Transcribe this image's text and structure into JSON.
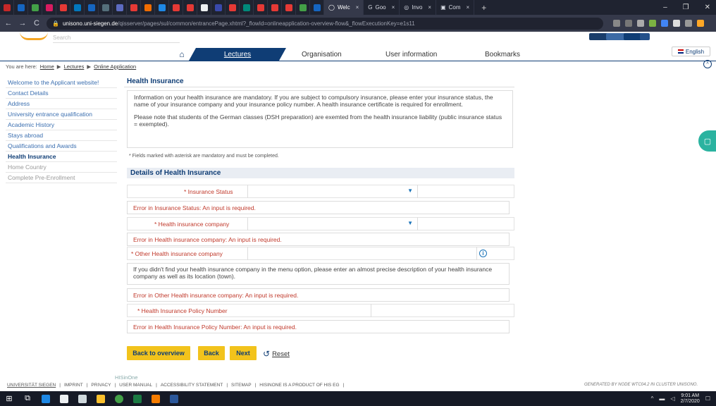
{
  "browser": {
    "tabs": [
      {
        "label": "Welc",
        "active": true
      },
      {
        "label": "Goo",
        "active": false
      },
      {
        "label": "Invo",
        "active": false
      },
      {
        "label": "Com",
        "active": false
      }
    ],
    "url_host": "unisono.uni-siegen.de",
    "url_path": "/qisserver/pages/sul/common/entrancePage.xhtml?_flowId=onlineapplication-overview-flow&_flowExecutionKey=e1s11"
  },
  "site": {
    "search_placeholder": "Search",
    "nav": {
      "home_icon": "home-icon",
      "active": "Lectures",
      "items": [
        "Organisation",
        "User information",
        "Bookmarks"
      ]
    },
    "language": "English"
  },
  "breadcrumb": {
    "prefix": "You are here:",
    "items": [
      "Home",
      "Lectures",
      "Online Application"
    ]
  },
  "sidebar": {
    "items": [
      {
        "label": "Welcome to the Applicant website!",
        "state": "link"
      },
      {
        "label": "Contact Details",
        "state": "link"
      },
      {
        "label": "Address",
        "state": "link"
      },
      {
        "label": "University entrance qualification",
        "state": "link"
      },
      {
        "label": "Academic History",
        "state": "link"
      },
      {
        "label": "Stays abroad",
        "state": "link"
      },
      {
        "label": "Qualifications and Awards",
        "state": "link"
      },
      {
        "label": "Health Insurance",
        "state": "active"
      },
      {
        "label": "Home Country",
        "state": "muted"
      },
      {
        "label": "Complete Pre-Enrollment",
        "state": "muted"
      }
    ]
  },
  "main": {
    "title": "Health Insurance",
    "info_p1": "Information on your health insurance are mandatory. If you are subject to compulsory insurance, please enter your insurance status, the name of your insurance company and your insurance policy number. A health insurance certificate is required for enrollment.",
    "info_p2": "Please note that students of the German classes (DSH preparation) are exemted from the health insurance liability (public insurance status = exempted).",
    "mandatory_note": "* Fields marked with asterisk are mandatory and must be completed.",
    "section_title": "Details of Health Insurance",
    "fields": {
      "status_label": "* Insurance Status",
      "status_error": "Error in Insurance Status: An input is required.",
      "company_label": "* Health insurance company",
      "company_error": "Error in Health insurance company: An input is required.",
      "other_label": "* Other Health insurance company",
      "other_help": "If you didn't find your health insurance company in the menu option, please enter an almost precise description of your health insurance company as well as its location (town).",
      "other_error": "Error in Other Health insurance company: An input is required.",
      "policy_label": "* Health Insurance Policy Number",
      "policy_error": "Error in Health Insurance Policy Number: An input is required."
    },
    "buttons": {
      "back": "Back to overview",
      "back_short": "Back",
      "next": "Next",
      "reset": "Reset"
    }
  },
  "footer": {
    "brand": "HISinOne",
    "links": [
      "UNIVERSITÄT SIEGEN",
      "IMPRINT",
      "PRIVACY",
      "USER MANUAL",
      "ACCESSIBILITY STATEMENT",
      "SITEMAP",
      "HISINONE IS A PRODUCT OF HIS EG"
    ],
    "generated": "GENERATED BY NODE WTC04.2 IN CLUSTER UNISONO."
  },
  "taskbar": {
    "time": "9:01 AM",
    "date": "2/7/2020"
  },
  "colors": {
    "primary": "#0f3d75",
    "accent_button": "#f2c31c",
    "error": "#c0392b",
    "link": "#3b6fb0"
  }
}
